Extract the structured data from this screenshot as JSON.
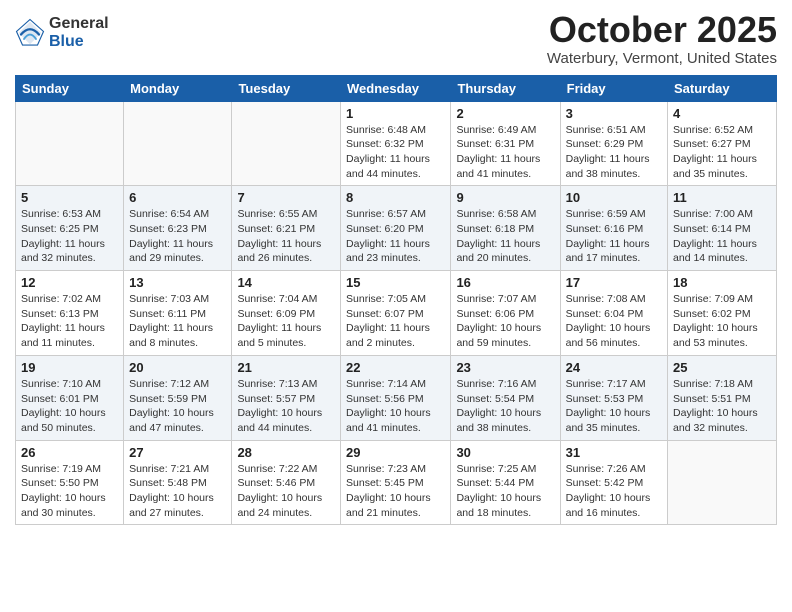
{
  "header": {
    "logo_general": "General",
    "logo_blue": "Blue",
    "month_title": "October 2025",
    "location": "Waterbury, Vermont, United States"
  },
  "days_of_week": [
    "Sunday",
    "Monday",
    "Tuesday",
    "Wednesday",
    "Thursday",
    "Friday",
    "Saturday"
  ],
  "weeks": [
    [
      {
        "day": "",
        "info": ""
      },
      {
        "day": "",
        "info": ""
      },
      {
        "day": "",
        "info": ""
      },
      {
        "day": "1",
        "info": "Sunrise: 6:48 AM\nSunset: 6:32 PM\nDaylight: 11 hours\nand 44 minutes."
      },
      {
        "day": "2",
        "info": "Sunrise: 6:49 AM\nSunset: 6:31 PM\nDaylight: 11 hours\nand 41 minutes."
      },
      {
        "day": "3",
        "info": "Sunrise: 6:51 AM\nSunset: 6:29 PM\nDaylight: 11 hours\nand 38 minutes."
      },
      {
        "day": "4",
        "info": "Sunrise: 6:52 AM\nSunset: 6:27 PM\nDaylight: 11 hours\nand 35 minutes."
      }
    ],
    [
      {
        "day": "5",
        "info": "Sunrise: 6:53 AM\nSunset: 6:25 PM\nDaylight: 11 hours\nand 32 minutes."
      },
      {
        "day": "6",
        "info": "Sunrise: 6:54 AM\nSunset: 6:23 PM\nDaylight: 11 hours\nand 29 minutes."
      },
      {
        "day": "7",
        "info": "Sunrise: 6:55 AM\nSunset: 6:21 PM\nDaylight: 11 hours\nand 26 minutes."
      },
      {
        "day": "8",
        "info": "Sunrise: 6:57 AM\nSunset: 6:20 PM\nDaylight: 11 hours\nand 23 minutes."
      },
      {
        "day": "9",
        "info": "Sunrise: 6:58 AM\nSunset: 6:18 PM\nDaylight: 11 hours\nand 20 minutes."
      },
      {
        "day": "10",
        "info": "Sunrise: 6:59 AM\nSunset: 6:16 PM\nDaylight: 11 hours\nand 17 minutes."
      },
      {
        "day": "11",
        "info": "Sunrise: 7:00 AM\nSunset: 6:14 PM\nDaylight: 11 hours\nand 14 minutes."
      }
    ],
    [
      {
        "day": "12",
        "info": "Sunrise: 7:02 AM\nSunset: 6:13 PM\nDaylight: 11 hours\nand 11 minutes."
      },
      {
        "day": "13",
        "info": "Sunrise: 7:03 AM\nSunset: 6:11 PM\nDaylight: 11 hours\nand 8 minutes."
      },
      {
        "day": "14",
        "info": "Sunrise: 7:04 AM\nSunset: 6:09 PM\nDaylight: 11 hours\nand 5 minutes."
      },
      {
        "day": "15",
        "info": "Sunrise: 7:05 AM\nSunset: 6:07 PM\nDaylight: 11 hours\nand 2 minutes."
      },
      {
        "day": "16",
        "info": "Sunrise: 7:07 AM\nSunset: 6:06 PM\nDaylight: 10 hours\nand 59 minutes."
      },
      {
        "day": "17",
        "info": "Sunrise: 7:08 AM\nSunset: 6:04 PM\nDaylight: 10 hours\nand 56 minutes."
      },
      {
        "day": "18",
        "info": "Sunrise: 7:09 AM\nSunset: 6:02 PM\nDaylight: 10 hours\nand 53 minutes."
      }
    ],
    [
      {
        "day": "19",
        "info": "Sunrise: 7:10 AM\nSunset: 6:01 PM\nDaylight: 10 hours\nand 50 minutes."
      },
      {
        "day": "20",
        "info": "Sunrise: 7:12 AM\nSunset: 5:59 PM\nDaylight: 10 hours\nand 47 minutes."
      },
      {
        "day": "21",
        "info": "Sunrise: 7:13 AM\nSunset: 5:57 PM\nDaylight: 10 hours\nand 44 minutes."
      },
      {
        "day": "22",
        "info": "Sunrise: 7:14 AM\nSunset: 5:56 PM\nDaylight: 10 hours\nand 41 minutes."
      },
      {
        "day": "23",
        "info": "Sunrise: 7:16 AM\nSunset: 5:54 PM\nDaylight: 10 hours\nand 38 minutes."
      },
      {
        "day": "24",
        "info": "Sunrise: 7:17 AM\nSunset: 5:53 PM\nDaylight: 10 hours\nand 35 minutes."
      },
      {
        "day": "25",
        "info": "Sunrise: 7:18 AM\nSunset: 5:51 PM\nDaylight: 10 hours\nand 32 minutes."
      }
    ],
    [
      {
        "day": "26",
        "info": "Sunrise: 7:19 AM\nSunset: 5:50 PM\nDaylight: 10 hours\nand 30 minutes."
      },
      {
        "day": "27",
        "info": "Sunrise: 7:21 AM\nSunset: 5:48 PM\nDaylight: 10 hours\nand 27 minutes."
      },
      {
        "day": "28",
        "info": "Sunrise: 7:22 AM\nSunset: 5:46 PM\nDaylight: 10 hours\nand 24 minutes."
      },
      {
        "day": "29",
        "info": "Sunrise: 7:23 AM\nSunset: 5:45 PM\nDaylight: 10 hours\nand 21 minutes."
      },
      {
        "day": "30",
        "info": "Sunrise: 7:25 AM\nSunset: 5:44 PM\nDaylight: 10 hours\nand 18 minutes."
      },
      {
        "day": "31",
        "info": "Sunrise: 7:26 AM\nSunset: 5:42 PM\nDaylight: 10 hours\nand 16 minutes."
      },
      {
        "day": "",
        "info": ""
      }
    ]
  ]
}
